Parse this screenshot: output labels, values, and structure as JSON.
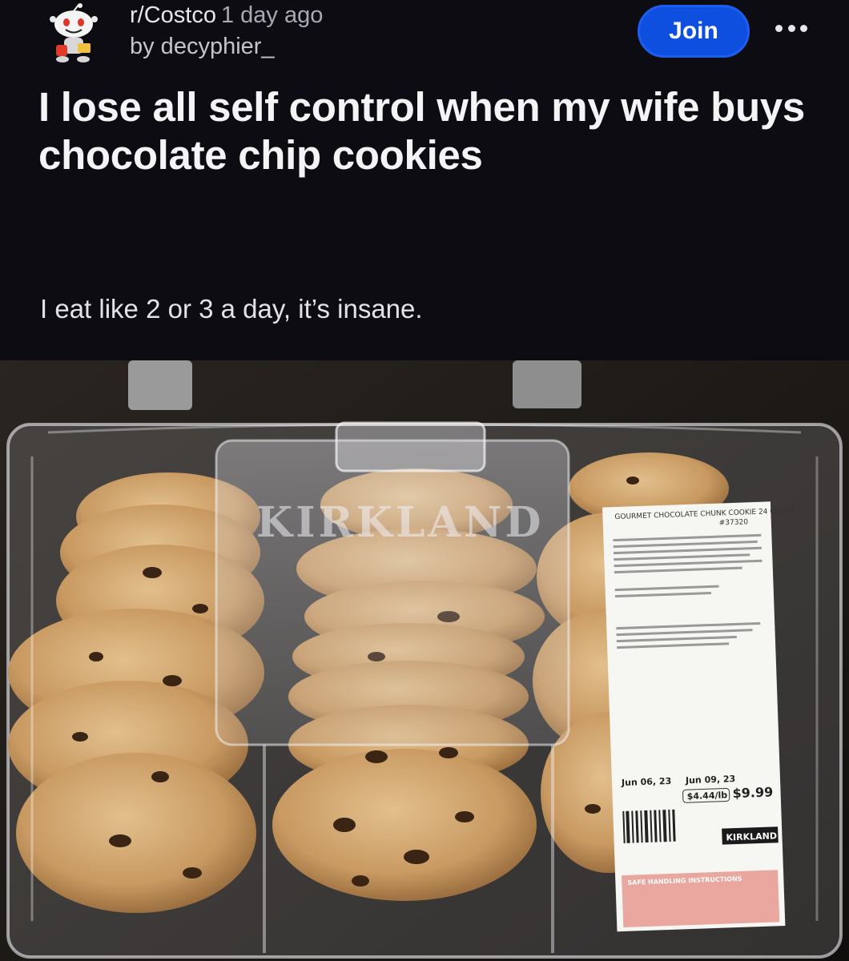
{
  "post": {
    "subreddit": "r/Costco",
    "time_ago": "1 day ago",
    "author_line": "by decyphier_",
    "join_label": "Join",
    "title": "I lose all self control when my wife buys chocolate chip cookies",
    "body": "I eat like 2 or 3 a day, it’s insane."
  },
  "photo": {
    "brand_embossed": "KIRKLAND",
    "label": {
      "product": "GOURMET CHOCOLATE CHUNK COOKIE 24 COUNT",
      "item_number": "#37320",
      "pack_date": "Jun 06, 23",
      "sell_by": "Jun 09, 23",
      "unit_price": "$4.44/lb",
      "total_price": "$9.99",
      "brand_tag": "KIRKLAND",
      "safe_handling": "SAFE HANDLING INSTRUCTIONS"
    }
  },
  "icons": {
    "avatar": "reddit-snoo-avatar-icon",
    "more": "more-options-icon"
  },
  "colors": {
    "background": "#0c0c12",
    "join_button": "#0f4fe0"
  }
}
